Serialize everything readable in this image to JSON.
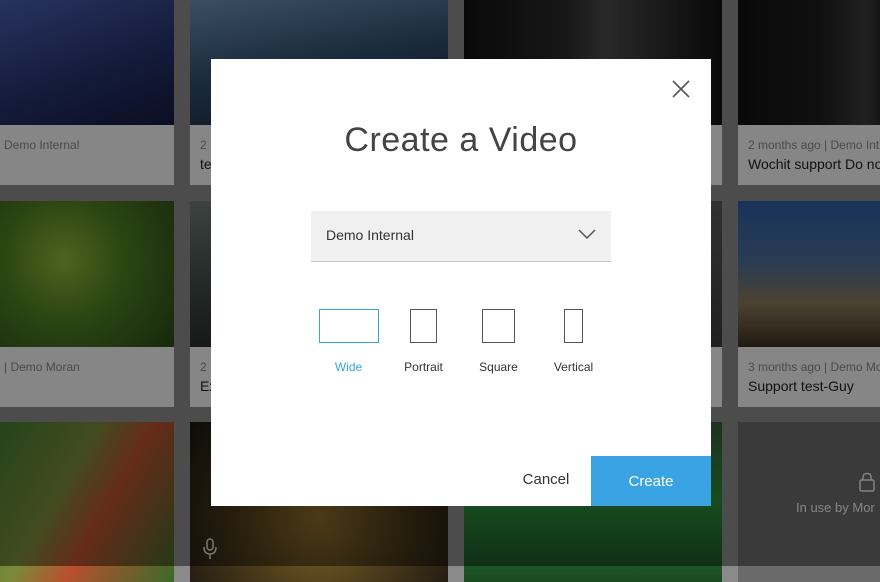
{
  "background_cards": [
    {
      "meta": "Demo Internal",
      "title": ""
    },
    {
      "meta": "2",
      "title": "te"
    },
    {
      "meta": "",
      "title": ""
    },
    {
      "meta": "2 months ago | Demo Int",
      "title": "Wochit support Do no"
    },
    {
      "meta": "| Demo Moran",
      "title": ""
    },
    {
      "meta": "2",
      "title": "Ex"
    },
    {
      "meta": "",
      "title": ""
    },
    {
      "meta": "3 months ago | Demo Mo",
      "title": "Support test-Guy"
    },
    {
      "meta": "",
      "title": ""
    },
    {
      "meta": "",
      "title": ""
    },
    {
      "meta": "",
      "title": ""
    },
    {
      "meta": "",
      "title": "",
      "lock_text": "In use by Mor"
    }
  ],
  "dialog": {
    "title": "Create a Video",
    "account_select": {
      "value": "Demo Internal"
    },
    "formats": [
      {
        "label": "Wide",
        "selected": true
      },
      {
        "label": "Portrait",
        "selected": false
      },
      {
        "label": "Square",
        "selected": false
      },
      {
        "label": "Vertical",
        "selected": false
      }
    ],
    "cancel_label": "Cancel",
    "create_label": "Create"
  },
  "colors": {
    "accent": "#3aa3e3",
    "overlay": "rgba(0,0,0,0.45)"
  },
  "icons": [
    "close-icon",
    "chevron-down-icon",
    "microphone-icon",
    "lock-icon"
  ]
}
